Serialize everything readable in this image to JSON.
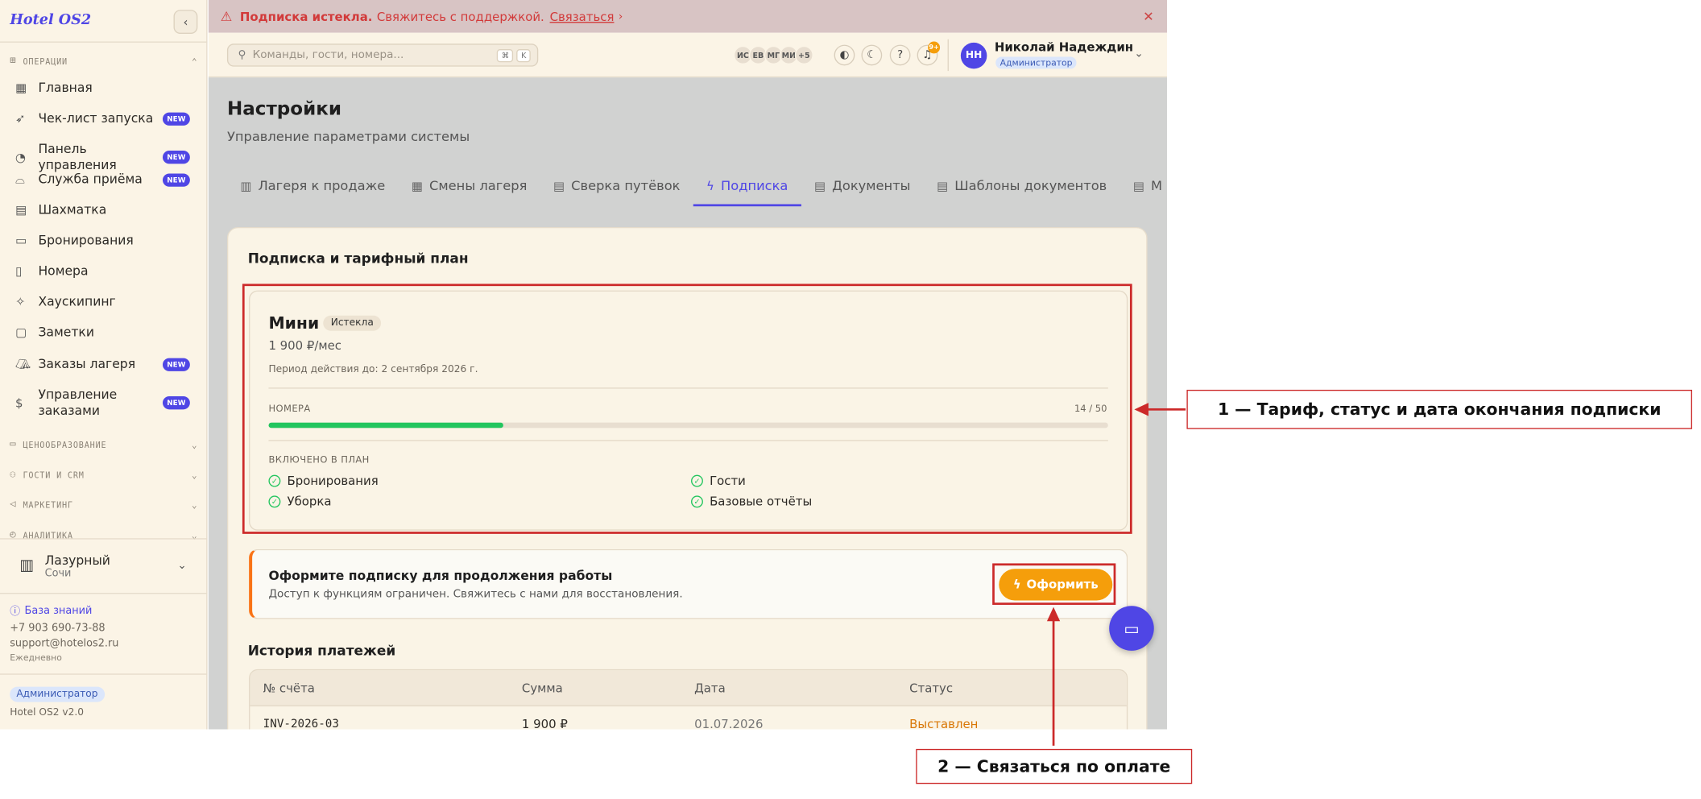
{
  "app": {
    "logo": "Hotel OS2",
    "version": "Hotel OS2 v2.0"
  },
  "sidebar": {
    "sections": {
      "operations": "ОПЕРАЦИИ",
      "pricing": "ЦЕНООБРАЗОВАНИЕ",
      "guests": "ГОСТИ И CRM",
      "marketing": "МАРКЕТИНГ",
      "analytics": "АНАЛИТИКА"
    },
    "items": [
      {
        "label": "Главная",
        "new": ""
      },
      {
        "label": "Чек-лист запуска",
        "new": "NEW"
      },
      {
        "label": "Панель управления",
        "new": "NEW"
      },
      {
        "label": "Служба приёма",
        "new": "NEW"
      },
      {
        "label": "Шахматка",
        "new": ""
      },
      {
        "label": "Бронирования",
        "new": ""
      },
      {
        "label": "Номера",
        "new": ""
      },
      {
        "label": "Хаускипинг",
        "new": ""
      },
      {
        "label": "Заметки",
        "new": ""
      },
      {
        "label": "Заказы лагеря",
        "new": "NEW"
      },
      {
        "label": "Управление заказами",
        "new": "NEW"
      }
    ],
    "hotel": {
      "name": "Лазурный",
      "city": "Сочи"
    },
    "knowledge_base": "База знаний",
    "phone": "+7 903 690-73-88",
    "email": "support@hotelos2.ru",
    "hours": "Ежедневно",
    "role": "Администратор"
  },
  "alert": {
    "title": "Подписка истекла.",
    "text": "Свяжитесь с поддержкой.",
    "link": "Связаться"
  },
  "topbar": {
    "search_placeholder": "Команды, гости, номера...",
    "kbd1": "⌘",
    "kbd2": "K",
    "avatars": [
      "ИС",
      "ЕВ",
      "МГ",
      "МИ",
      "+5"
    ],
    "notif_count": "9+",
    "user": {
      "initials": "НН",
      "name": "Николай Надеждин",
      "role": "Администратор"
    }
  },
  "page": {
    "title": "Настройки",
    "subtitle": "Управление параметрами системы",
    "tabs": [
      {
        "label": "Лагеря к продаже"
      },
      {
        "label": "Смены лагеря"
      },
      {
        "label": "Сверка путёвок"
      },
      {
        "label": "Подписка"
      },
      {
        "label": "Документы"
      },
      {
        "label": "Шаблоны документов"
      },
      {
        "label": "М"
      }
    ]
  },
  "subscription": {
    "card_title": "Подписка и тарифный план",
    "plan_name": "Мини",
    "status": "Истекла",
    "price": "1 900 ₽/мес",
    "period": "Период действия до: 2 сентября 2026 г.",
    "rooms_label": "НОМЕРА",
    "rooms_count": "14 / 50",
    "rooms_fraction": 0.28,
    "included_label": "ВКЛЮЧЕНО В ПЛАН",
    "features": [
      "Бронирования",
      "Гости",
      "Уборка",
      "Базовые отчёты"
    ],
    "cta_title": "Оформите подписку для продолжения работы",
    "cta_text": "Доступ к функциям ограничен. Свяжитесь с нами для восстановления.",
    "cta_button": "Оформить"
  },
  "history": {
    "title": "История платежей",
    "columns": [
      "№ счёта",
      "Сумма",
      "Дата",
      "Статус"
    ],
    "rows": [
      {
        "invoice": "INV-2026-03",
        "amount": "1 900 ₽",
        "date": "01.07.2026",
        "status": "Выставлен"
      }
    ]
  },
  "annotations": {
    "callout1": "1 — Тариф, статус и дата окончания подписки",
    "callout2": "2 — Связаться по оплате"
  },
  "colors": {
    "accent": "#4f46e5",
    "cta": "#f59e0b",
    "alert": "#d23a3a",
    "annotation": "#cc2a2a",
    "success": "#22c55e"
  }
}
